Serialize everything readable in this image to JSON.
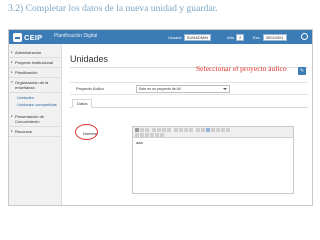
{
  "slide": {
    "heading": "3.2) Completar los datos de la nueva unidad y guardar."
  },
  "app": {
    "logo_text": "CEIP",
    "title": "Planificación Digital"
  },
  "header_controls": {
    "user_label": "Usuario",
    "user_value": "SUNADMIN",
    "year_label": "Año",
    "year_value": "2",
    "school_label": "Esc.",
    "school_value": "30010001"
  },
  "sidebar": {
    "items": [
      {
        "label": "Administración"
      },
      {
        "label": "Proyecto Institucional"
      },
      {
        "label": "Planificación"
      },
      {
        "label": "Organización de la enseñanza"
      }
    ],
    "subitems": [
      {
        "label": "Unidades"
      },
      {
        "label": "Unidades compartidas"
      }
    ],
    "items_after": [
      {
        "label": "Presentación de Conocimiento"
      },
      {
        "label": "Recursos"
      }
    ]
  },
  "main": {
    "page_title": "Unidades",
    "annotation": "Seleccionar el proyecto áulico",
    "filter": {
      "label": "Proyecto Áulico",
      "selected": "Este es un proyecto de Ali"
    },
    "tabs": [
      {
        "label": "Datos"
      }
    ],
    "field_label": "Nombre",
    "editor_value": "aaa"
  },
  "colors": {
    "header_blue": "#3b7bb6",
    "annotation_red": "#e0302a",
    "heading_blue": "#7aa7c7"
  }
}
